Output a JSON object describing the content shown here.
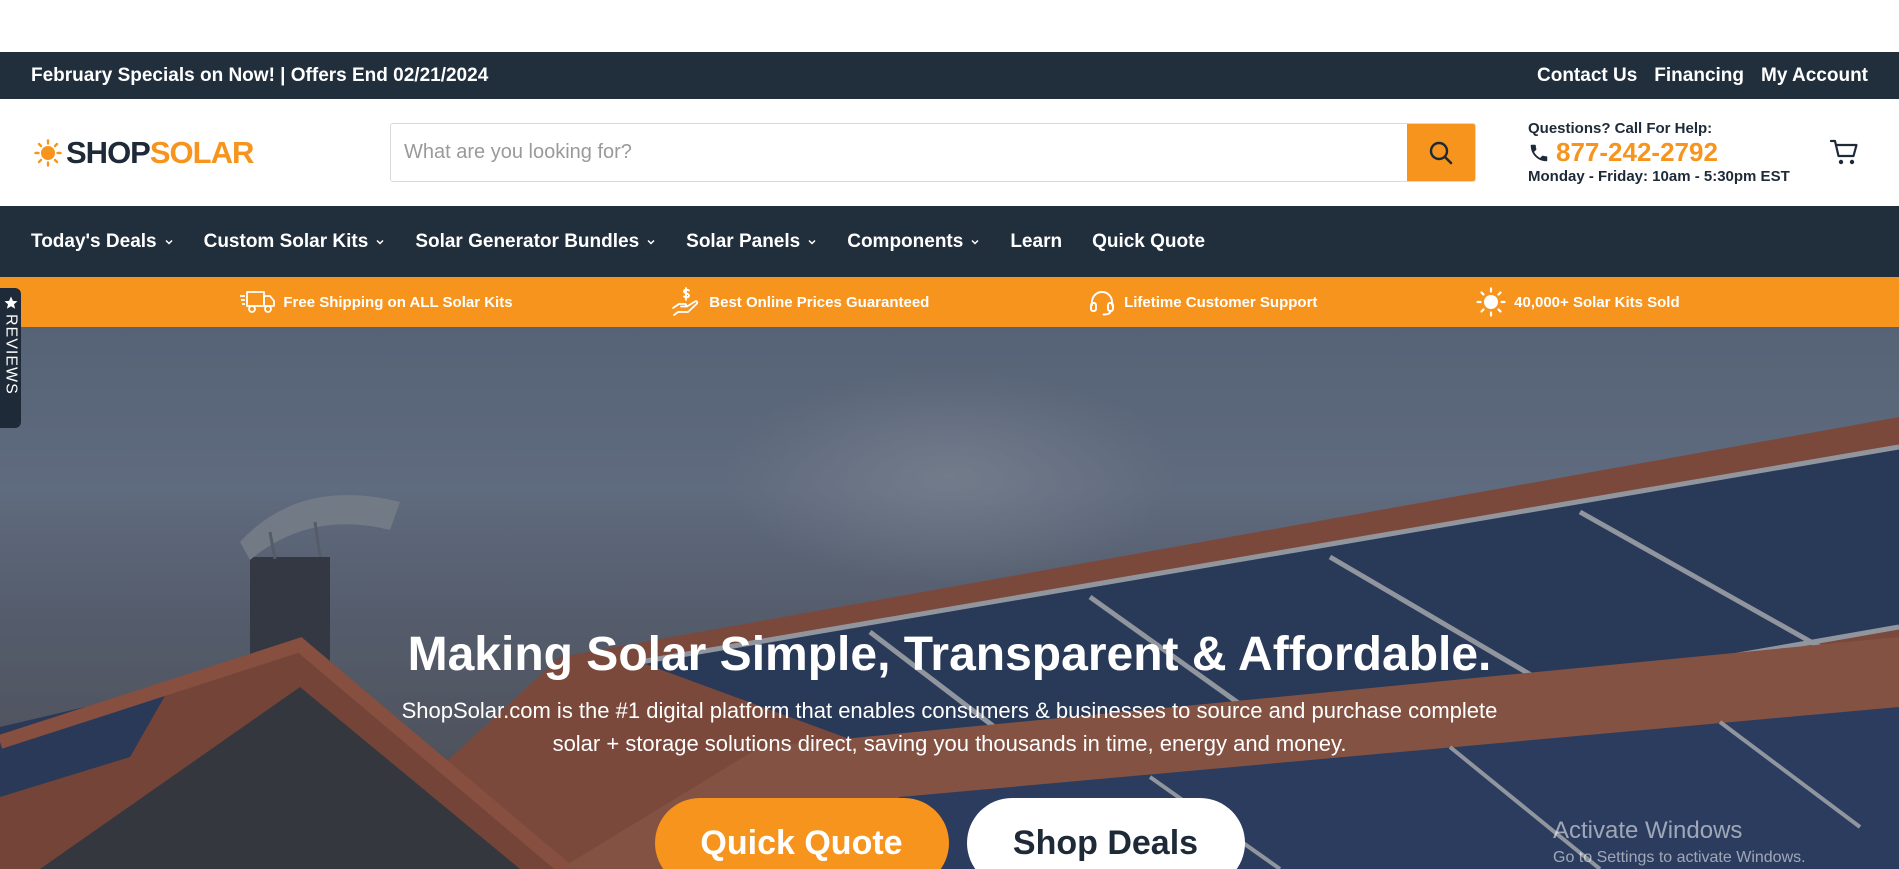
{
  "announcement": {
    "promo": "February Specials on Now! | Offers End 02/21/2024",
    "links": [
      "Contact Us",
      "Financing",
      "My Account"
    ]
  },
  "header": {
    "logo_part1": "SHOP",
    "logo_part2": "SOLAR",
    "search_placeholder": "What are you looking for?",
    "help_question": "Questions? Call For Help:",
    "phone": "877-242-2792",
    "hours": "Monday - Friday: 10am - 5:30pm EST"
  },
  "nav": {
    "items": [
      {
        "label": "Today's Deals",
        "dropdown": true
      },
      {
        "label": "Custom Solar Kits",
        "dropdown": true
      },
      {
        "label": "Solar Generator Bundles",
        "dropdown": true
      },
      {
        "label": "Solar Panels",
        "dropdown": true
      },
      {
        "label": "Components",
        "dropdown": true
      },
      {
        "label": "Learn",
        "dropdown": false
      },
      {
        "label": "Quick Quote",
        "dropdown": false
      }
    ]
  },
  "benefits": [
    {
      "icon": "truck-icon",
      "label": "Free Shipping on ALL Solar Kits"
    },
    {
      "icon": "hand-dollar-icon",
      "label": "Best Online Prices Guaranteed"
    },
    {
      "icon": "headset-icon",
      "label": "Lifetime Customer Support"
    },
    {
      "icon": "sun-icon",
      "label": "40,000+ Solar Kits Sold"
    }
  ],
  "hero": {
    "title": "Making Solar Simple, Transparent & Affordable.",
    "description": "ShopSolar.com is the #1 digital platform that enables consumers & businesses to source and purchase complete solar + storage solutions direct, saving you thousands in time, energy and money.",
    "primary_cta": "Quick Quote",
    "secondary_cta": "Shop Deals"
  },
  "reviews_tab": "REVIEWS",
  "watermark": {
    "line1": "Activate Windows",
    "line2": "Go to Settings to activate Windows."
  },
  "colors": {
    "navy": "#212e3c",
    "orange": "#f7941d"
  }
}
